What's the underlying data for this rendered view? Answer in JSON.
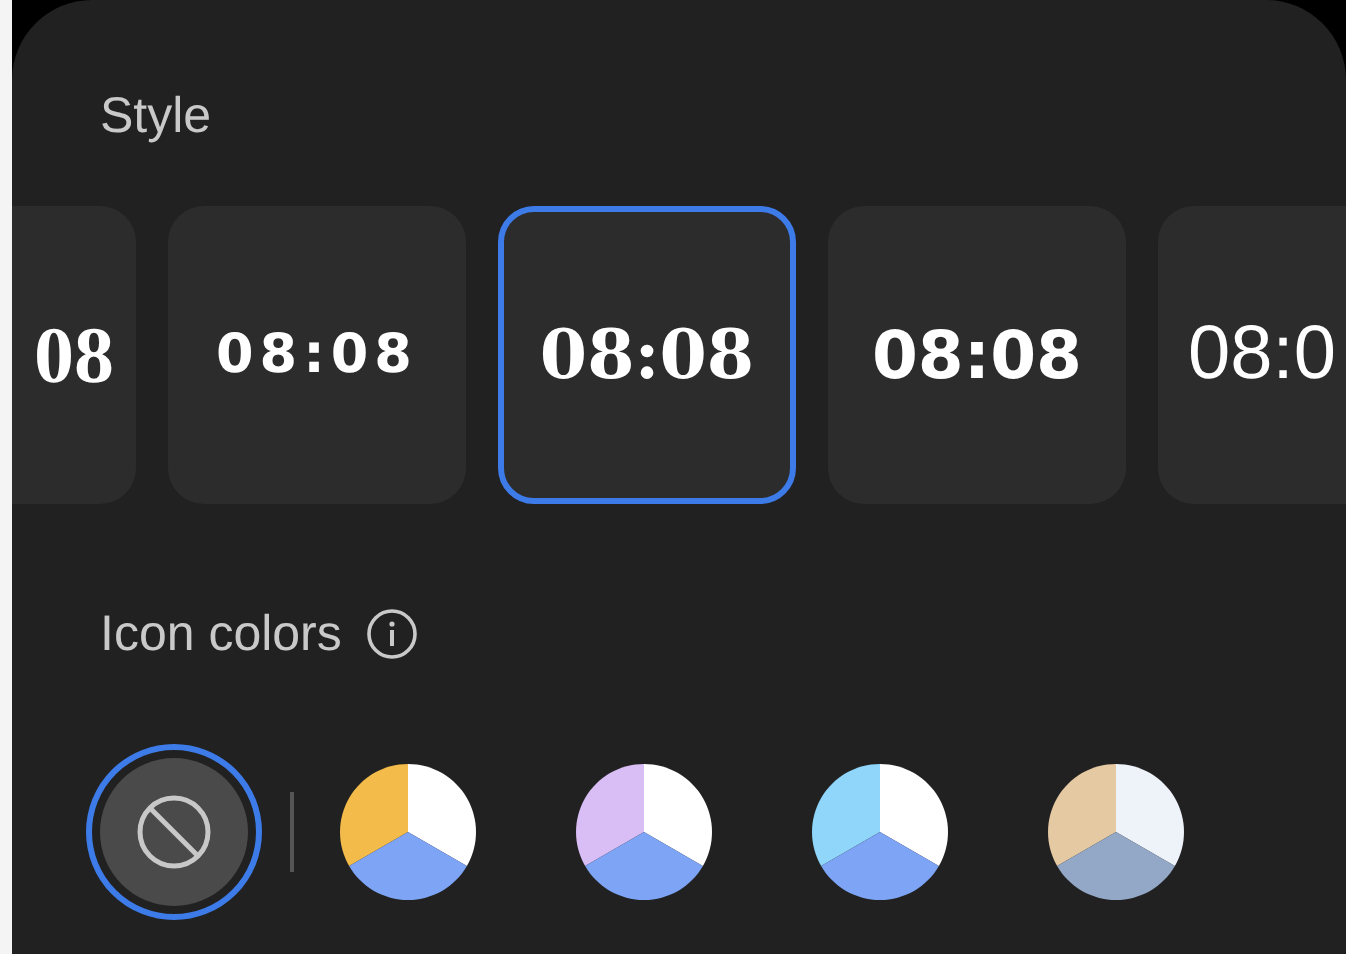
{
  "style_section": {
    "title": "Style",
    "clocks": [
      {
        "text": "08",
        "kind": "serif",
        "selected": false
      },
      {
        "text": "08:08",
        "kind": "wide",
        "selected": false
      },
      {
        "text": "08:08",
        "kind": "didone",
        "selected": true
      },
      {
        "text": "08:08",
        "kind": "bold",
        "selected": false
      },
      {
        "text": "08:0",
        "kind": "regular",
        "selected": false
      }
    ]
  },
  "icon_colors": {
    "title": "Icon colors",
    "none_option": {
      "selected": true
    },
    "swatches": [
      {
        "slices": [
          {
            "color": "#f2bb4a"
          },
          {
            "color": "#ffffff"
          },
          {
            "color": "#7ea4f5"
          }
        ],
        "selected": false
      },
      {
        "slices": [
          {
            "color": "#d9bdf5"
          },
          {
            "color": "#ffffff"
          },
          {
            "color": "#7ea4f5"
          }
        ],
        "selected": false
      },
      {
        "slices": [
          {
            "color": "#8fd6fa"
          },
          {
            "color": "#ffffff"
          },
          {
            "color": "#7ea4f5"
          }
        ],
        "selected": false
      },
      {
        "slices": [
          {
            "color": "#e5c9a3"
          },
          {
            "color": "#eef3fa"
          },
          {
            "color": "#93a8c6"
          }
        ],
        "selected": false
      }
    ]
  }
}
